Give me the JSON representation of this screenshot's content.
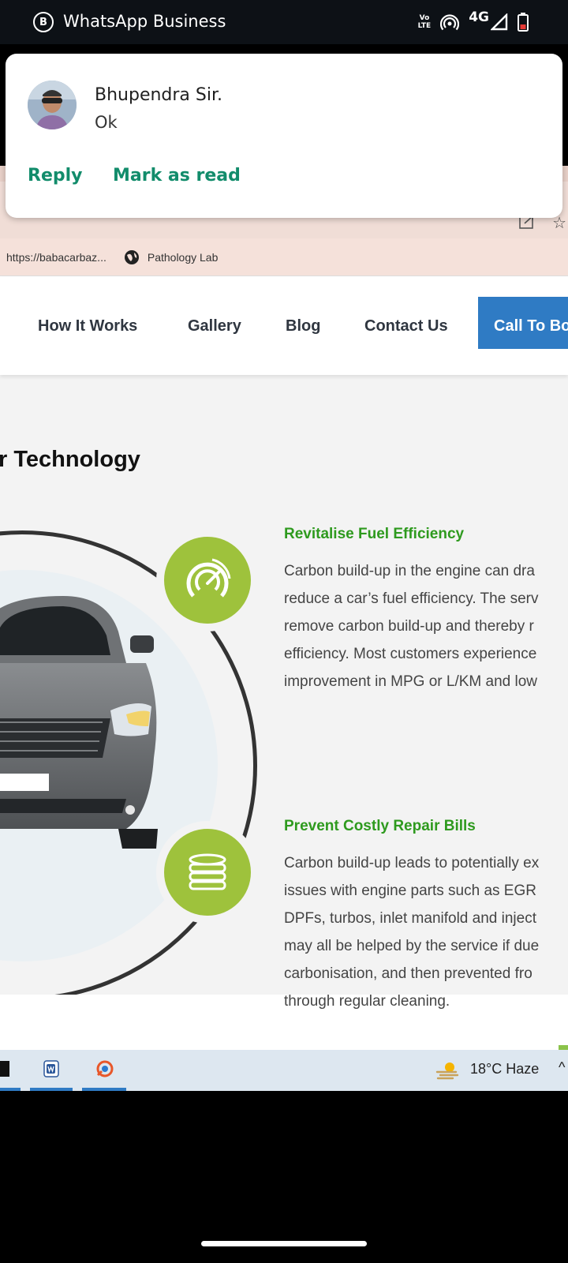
{
  "status_bar": {
    "app_icon_letter": "B",
    "app_name": "WhatsApp Business",
    "volte_line1": "Vo",
    "volte_line2": "LTE",
    "network": "4G"
  },
  "notification": {
    "sender": "Bhupendra Sir.",
    "message": "Ok",
    "actions": [
      "Reply",
      "Mark as read"
    ]
  },
  "browser": {
    "bookmarks": [
      {
        "label": "https://babacarbaz...",
        "icon": "link"
      },
      {
        "label": "Pathology Lab",
        "icon": "globe-icon"
      }
    ]
  },
  "site": {
    "nav": [
      "How It Works",
      "Gallery",
      "Blog",
      "Contact Us"
    ],
    "cta": "Call To Bo",
    "section_title": "r Technology",
    "features": [
      {
        "icon": "speedometer-icon",
        "title": "Revitalise Fuel Efficiency",
        "lines": [
          "Carbon build-up in the engine can dra",
          "reduce a car’s fuel efficiency. The serv",
          "remove carbon build-up and thereby r",
          "efficiency. Most customers experience",
          "improvement in MPG or L/KM and low"
        ]
      },
      {
        "icon": "coins-icon",
        "title": "Prevent Costly Repair Bills",
        "lines": [
          "Carbon build-up leads to potentially ex",
          "issues with engine parts such as EGR",
          "DPFs, turbos, inlet manifold and inject",
          "may all be helped by the service if due",
          "carbonisation, and then prevented fro",
          "through regular cleaning."
        ]
      }
    ]
  },
  "taskbar": {
    "weather": "18°C  Haze",
    "chevron": "^"
  },
  "colors": {
    "accent_green": "#2e9a1e",
    "badge_green": "#9ec23c",
    "cta_blue": "#2f7bc4",
    "whatsapp_green": "#128c6b"
  }
}
